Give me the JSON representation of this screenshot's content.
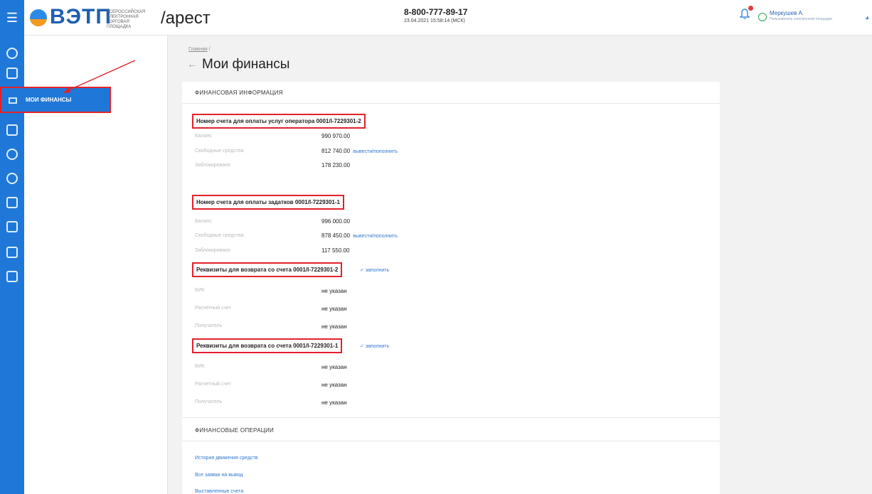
{
  "header": {
    "menu_icon": "menu-icon",
    "logo_text": "ВЭТП",
    "logo_sub": [
      "ВСЕРОССИЙСКАЯ",
      "ЭЛЕКТРОННАЯ",
      "ТОРГОВАЯ ПЛОЩАДКА"
    ],
    "section": "/арест",
    "phone": "8-800-777-89-17",
    "datetime": "23.04.2021 15:58:14 (МСК)",
    "user_name": "Меркушев А.",
    "user_role": "Пользователь электронной площадки"
  },
  "sidebar": {
    "icons": [
      "settings-icon",
      "document-icon",
      "finance-icon",
      "auction-icon",
      "person-icon",
      "person-alt-icon",
      "tools-icon",
      "list-icon",
      "home-icon",
      "report-icon"
    ],
    "active_item_label": "МОИ ФИНАНСЫ"
  },
  "page": {
    "breadcrumb": "Главная",
    "breadcrumb_sep": "/",
    "title": "Мои финансы"
  },
  "finance_info": {
    "section_title": "ФИНАНСОВАЯ ИНФОРМАЦИЯ",
    "operator_account": {
      "title": "Номер счета для оплаты услуг оператора 0001/I-7229301-2",
      "balance_label": "Баланс",
      "balance": "990 970.00",
      "free_label": "Свободные средства",
      "free": "812 740.00",
      "free_link": "вывести/пополнить",
      "blocked_label": "Заблокировано",
      "blocked": "178 230.00"
    },
    "deposit_account": {
      "title": "Номер счета для оплаты задатков 0001/I-7229301-1",
      "balance_label": "Баланс",
      "balance": "996 000.00",
      "free_label": "Свободные средства",
      "free": "878 450.00",
      "free_link": "вывести/пополнить",
      "blocked_label": "Заблокировано",
      "blocked": "117 550.00"
    },
    "refund_2": {
      "title": "Реквизиты для возврата со счета 0001/I-7229301-2",
      "fill_link": "заполнить",
      "bik_label": "БИК",
      "bik": "не указан",
      "account_label": "Расчетный счет",
      "account": "не указан",
      "recipient_label": "Получатель",
      "recipient": "не указан"
    },
    "refund_1": {
      "title": "Реквизиты для возврата со счета 0001/I-7229301-1",
      "fill_link": "заполнить",
      "bik_label": "БИК",
      "bik": "не указан",
      "account_label": "Расчетный счет",
      "account": "не указан",
      "recipient_label": "Получатель",
      "recipient": "не указан"
    }
  },
  "finance_ops": {
    "section_title": "ФИНАНСОВЫЕ ОПЕРАЦИИ",
    "links": [
      "История движения средств",
      "Все заявки на вывод",
      "Выставленные счета"
    ]
  }
}
